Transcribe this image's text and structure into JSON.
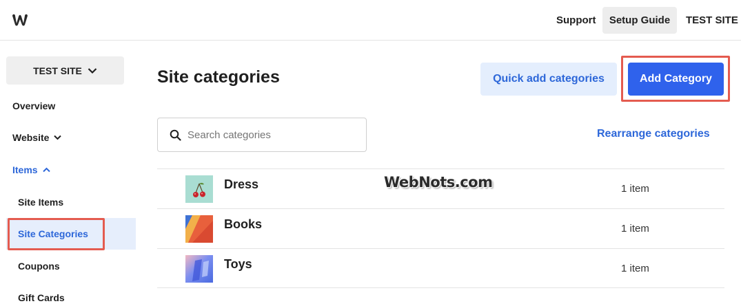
{
  "header": {
    "logo": "weebly-logo-icon",
    "support": "Support",
    "setup_guide": "Setup Guide",
    "site_name": "TEST SITE"
  },
  "sidebar": {
    "site_selector": "TEST SITE",
    "items": [
      {
        "label": "Overview"
      },
      {
        "label": "Website"
      },
      {
        "label": "Items"
      },
      {
        "label": "Site Items"
      },
      {
        "label": "Site Categories"
      },
      {
        "label": "Coupons"
      },
      {
        "label": "Gift Cards"
      }
    ]
  },
  "main": {
    "title": "Site categories",
    "quick_add": "Quick add categories",
    "add_category": "Add Category",
    "search_placeholder": "Search categories",
    "rearrange": "Rearrange categories",
    "categories": [
      {
        "name": "Dress",
        "count": "1 item",
        "thumb": "cherry-image"
      },
      {
        "name": "Books",
        "count": "1 item",
        "thumb": "books-image"
      },
      {
        "name": "Toys",
        "count": "1 item",
        "thumb": "toys-image"
      }
    ]
  },
  "watermark": "WebNots.com",
  "colors": {
    "accent": "#2d67d9",
    "primary_button": "#2f62ec",
    "highlight": "#e45b4f",
    "active_bg": "#e6eefc"
  }
}
